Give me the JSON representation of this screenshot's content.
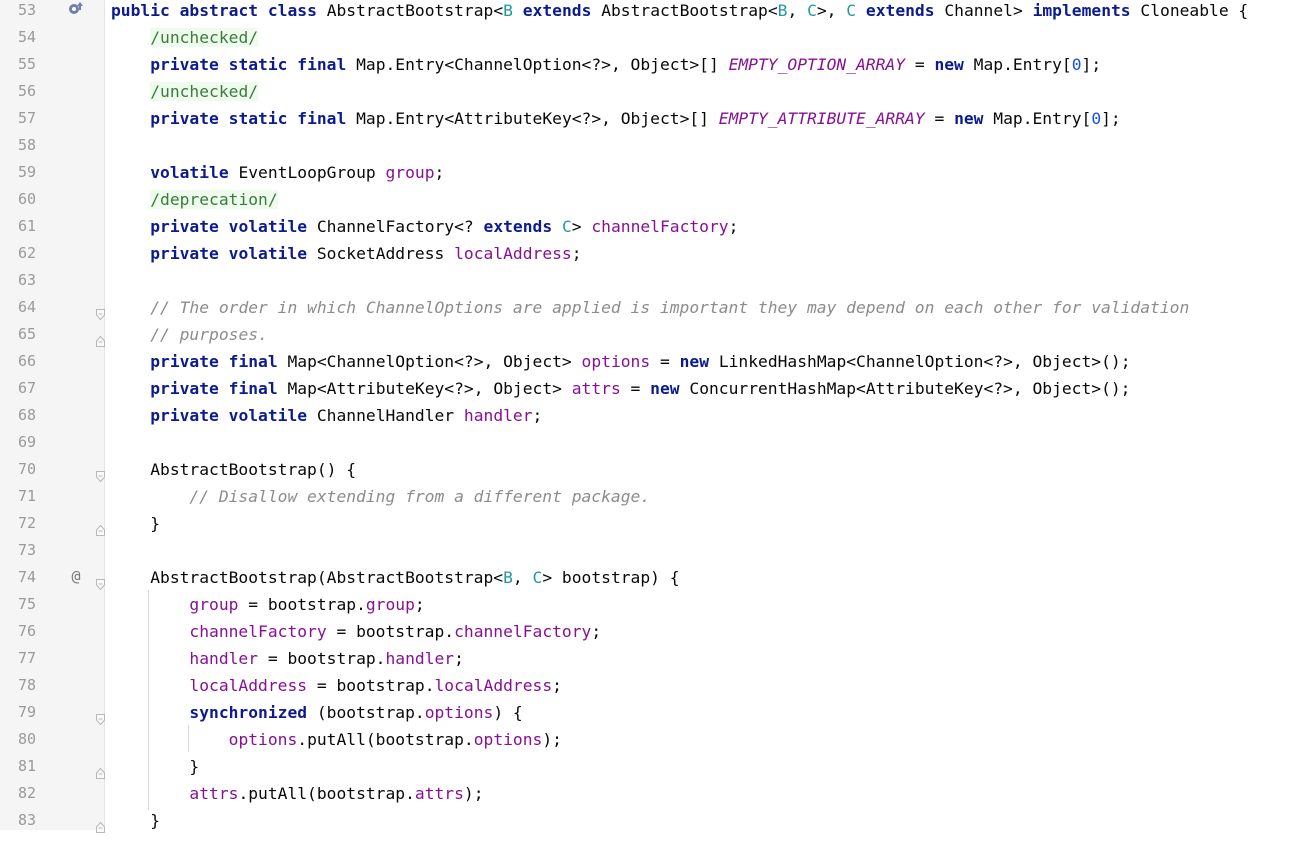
{
  "editor": {
    "lines": [
      {
        "n": "53",
        "tokens": [
          [
            "kw",
            "public "
          ],
          [
            "kw",
            "abstract "
          ],
          [
            "kw",
            "class "
          ],
          [
            "",
            "AbstractBootstrap<"
          ],
          [
            "tp",
            "B"
          ],
          [
            "",
            " "
          ],
          [
            "kw",
            "extends "
          ],
          [
            "",
            "AbstractBootstrap<"
          ],
          [
            "tp",
            "B"
          ],
          [
            "",
            ", "
          ],
          [
            "tp",
            "C"
          ],
          [
            "",
            ">, "
          ],
          [
            "tp",
            "C"
          ],
          [
            "",
            " "
          ],
          [
            "kw",
            "extends "
          ],
          [
            "",
            "Channel> "
          ],
          [
            "kw",
            "implements "
          ],
          [
            "",
            "Cloneable {"
          ]
        ],
        "gutter": "override"
      },
      {
        "n": "54",
        "tokens": [
          [
            "",
            "    "
          ],
          [
            "ann",
            "/unchecked/"
          ]
        ]
      },
      {
        "n": "55",
        "tokens": [
          [
            "",
            "    "
          ],
          [
            "kw",
            "private "
          ],
          [
            "kw",
            "static "
          ],
          [
            "kw",
            "final "
          ],
          [
            "",
            "Map.Entry<ChannelOption<?>, Object>[] "
          ],
          [
            "sf",
            "EMPTY_OPTION_ARRAY"
          ],
          [
            "",
            " = "
          ],
          [
            "kw",
            "new "
          ],
          [
            "",
            "Map.Entry["
          ],
          [
            "nm",
            "0"
          ],
          [
            "",
            "];"
          ]
        ]
      },
      {
        "n": "56",
        "tokens": [
          [
            "",
            "    "
          ],
          [
            "ann",
            "/unchecked/"
          ]
        ]
      },
      {
        "n": "57",
        "tokens": [
          [
            "",
            "    "
          ],
          [
            "kw",
            "private "
          ],
          [
            "kw",
            "static "
          ],
          [
            "kw",
            "final "
          ],
          [
            "",
            "Map.Entry<AttributeKey<?>, Object>[] "
          ],
          [
            "sf",
            "EMPTY_ATTRIBUTE_ARRAY"
          ],
          [
            "",
            " = "
          ],
          [
            "kw",
            "new "
          ],
          [
            "",
            "Map.Entry["
          ],
          [
            "nm",
            "0"
          ],
          [
            "",
            "];"
          ]
        ]
      },
      {
        "n": "58",
        "tokens": []
      },
      {
        "n": "59",
        "tokens": [
          [
            "",
            "    "
          ],
          [
            "kw",
            "volatile "
          ],
          [
            "",
            "EventLoopGroup "
          ],
          [
            "fd",
            "group"
          ],
          [
            "",
            ";"
          ]
        ]
      },
      {
        "n": "60",
        "tokens": [
          [
            "",
            "    "
          ],
          [
            "ann",
            "/deprecation/"
          ]
        ]
      },
      {
        "n": "61",
        "tokens": [
          [
            "",
            "    "
          ],
          [
            "kw",
            "private "
          ],
          [
            "kw",
            "volatile "
          ],
          [
            "",
            "ChannelFactory<? "
          ],
          [
            "kw",
            "extends "
          ],
          [
            "tp",
            "C"
          ],
          [
            "",
            "> "
          ],
          [
            "fd",
            "channelFactory"
          ],
          [
            "",
            ";"
          ]
        ]
      },
      {
        "n": "62",
        "tokens": [
          [
            "",
            "    "
          ],
          [
            "kw",
            "private "
          ],
          [
            "kw",
            "volatile "
          ],
          [
            "",
            "SocketAddress "
          ],
          [
            "fd",
            "localAddress"
          ],
          [
            "",
            ";"
          ]
        ]
      },
      {
        "n": "63",
        "tokens": []
      },
      {
        "n": "64",
        "tokens": [
          [
            "",
            "    "
          ],
          [
            "cm",
            "// The order in which ChannelOptions are applied is important they may depend on each other for validation"
          ]
        ],
        "fold": "start"
      },
      {
        "n": "65",
        "tokens": [
          [
            "",
            "    "
          ],
          [
            "cm",
            "// purposes."
          ]
        ],
        "fold": "end"
      },
      {
        "n": "66",
        "tokens": [
          [
            "",
            "    "
          ],
          [
            "kw",
            "private "
          ],
          [
            "kw",
            "final "
          ],
          [
            "",
            "Map<ChannelOption<?>, Object> "
          ],
          [
            "fd",
            "options"
          ],
          [
            "",
            " = "
          ],
          [
            "kw",
            "new "
          ],
          [
            "",
            "LinkedHashMap<ChannelOption<?>, Object>();"
          ]
        ]
      },
      {
        "n": "67",
        "tokens": [
          [
            "",
            "    "
          ],
          [
            "kw",
            "private "
          ],
          [
            "kw",
            "final "
          ],
          [
            "",
            "Map<AttributeKey<?>, Object> "
          ],
          [
            "fd",
            "attrs"
          ],
          [
            "",
            " = "
          ],
          [
            "kw",
            "new "
          ],
          [
            "",
            "ConcurrentHashMap<AttributeKey<?>, Object>();"
          ]
        ]
      },
      {
        "n": "68",
        "tokens": [
          [
            "",
            "    "
          ],
          [
            "kw",
            "private "
          ],
          [
            "kw",
            "volatile "
          ],
          [
            "",
            "ChannelHandler "
          ],
          [
            "fd",
            "handler"
          ],
          [
            "",
            ";"
          ]
        ]
      },
      {
        "n": "69",
        "tokens": []
      },
      {
        "n": "70",
        "tokens": [
          [
            "",
            "    AbstractBootstrap() {"
          ]
        ],
        "fold": "start"
      },
      {
        "n": "71",
        "tokens": [
          [
            "",
            "        "
          ],
          [
            "cm",
            "// Disallow extending from a different package."
          ]
        ]
      },
      {
        "n": "72",
        "tokens": [
          [
            "",
            "    }"
          ]
        ],
        "fold": "end"
      },
      {
        "n": "73",
        "tokens": []
      },
      {
        "n": "74",
        "tokens": [
          [
            "",
            "    AbstractBootstrap(AbstractBootstrap<"
          ],
          [
            "tp",
            "B"
          ],
          [
            "",
            ", "
          ],
          [
            "tp",
            "C"
          ],
          [
            "",
            "> bootstrap) {"
          ]
        ],
        "fold": "start",
        "gutter": "at"
      },
      {
        "n": "75",
        "tokens": [
          [
            "",
            "        "
          ],
          [
            "fd",
            "group"
          ],
          [
            "",
            " = bootstrap."
          ],
          [
            "fd",
            "group"
          ],
          [
            "",
            ";"
          ]
        ]
      },
      {
        "n": "76",
        "tokens": [
          [
            "",
            "        "
          ],
          [
            "fd",
            "channelFactory"
          ],
          [
            "",
            " = bootstrap."
          ],
          [
            "fd",
            "channelFactory"
          ],
          [
            "",
            ";"
          ]
        ]
      },
      {
        "n": "77",
        "tokens": [
          [
            "",
            "        "
          ],
          [
            "fd",
            "handler"
          ],
          [
            "",
            " = bootstrap."
          ],
          [
            "fd",
            "handler"
          ],
          [
            "",
            ";"
          ]
        ]
      },
      {
        "n": "78",
        "tokens": [
          [
            "",
            "        "
          ],
          [
            "fd",
            "localAddress"
          ],
          [
            "",
            " = bootstrap."
          ],
          [
            "fd",
            "localAddress"
          ],
          [
            "",
            ";"
          ]
        ]
      },
      {
        "n": "79",
        "tokens": [
          [
            "",
            "        "
          ],
          [
            "kw",
            "synchronized "
          ],
          [
            "",
            "(bootstrap."
          ],
          [
            "fd",
            "options"
          ],
          [
            "",
            ") {"
          ]
        ],
        "fold": "start"
      },
      {
        "n": "80",
        "tokens": [
          [
            "",
            "            "
          ],
          [
            "fd",
            "options"
          ],
          [
            "",
            ".putAll(bootstrap."
          ],
          [
            "fd",
            "options"
          ],
          [
            "",
            ");"
          ]
        ]
      },
      {
        "n": "81",
        "tokens": [
          [
            "",
            "        }"
          ]
        ],
        "fold": "end"
      },
      {
        "n": "82",
        "tokens": [
          [
            "",
            "        "
          ],
          [
            "fd",
            "attrs"
          ],
          [
            "",
            ".putAll(bootstrap."
          ],
          [
            "fd",
            "attrs"
          ],
          [
            "",
            ");"
          ]
        ]
      },
      {
        "n": "83",
        "tokens": [
          [
            "",
            "    }"
          ]
        ],
        "fold": "end"
      }
    ],
    "gutter_icons": {
      "override": "o↑",
      "at": "@"
    },
    "colors": {
      "keyword": "#0c1c8f",
      "type_param": "#20999d",
      "field": "#871094",
      "comment": "#8c8c8c",
      "number": "#1750eb",
      "annotation_bg": "#edfced"
    }
  }
}
